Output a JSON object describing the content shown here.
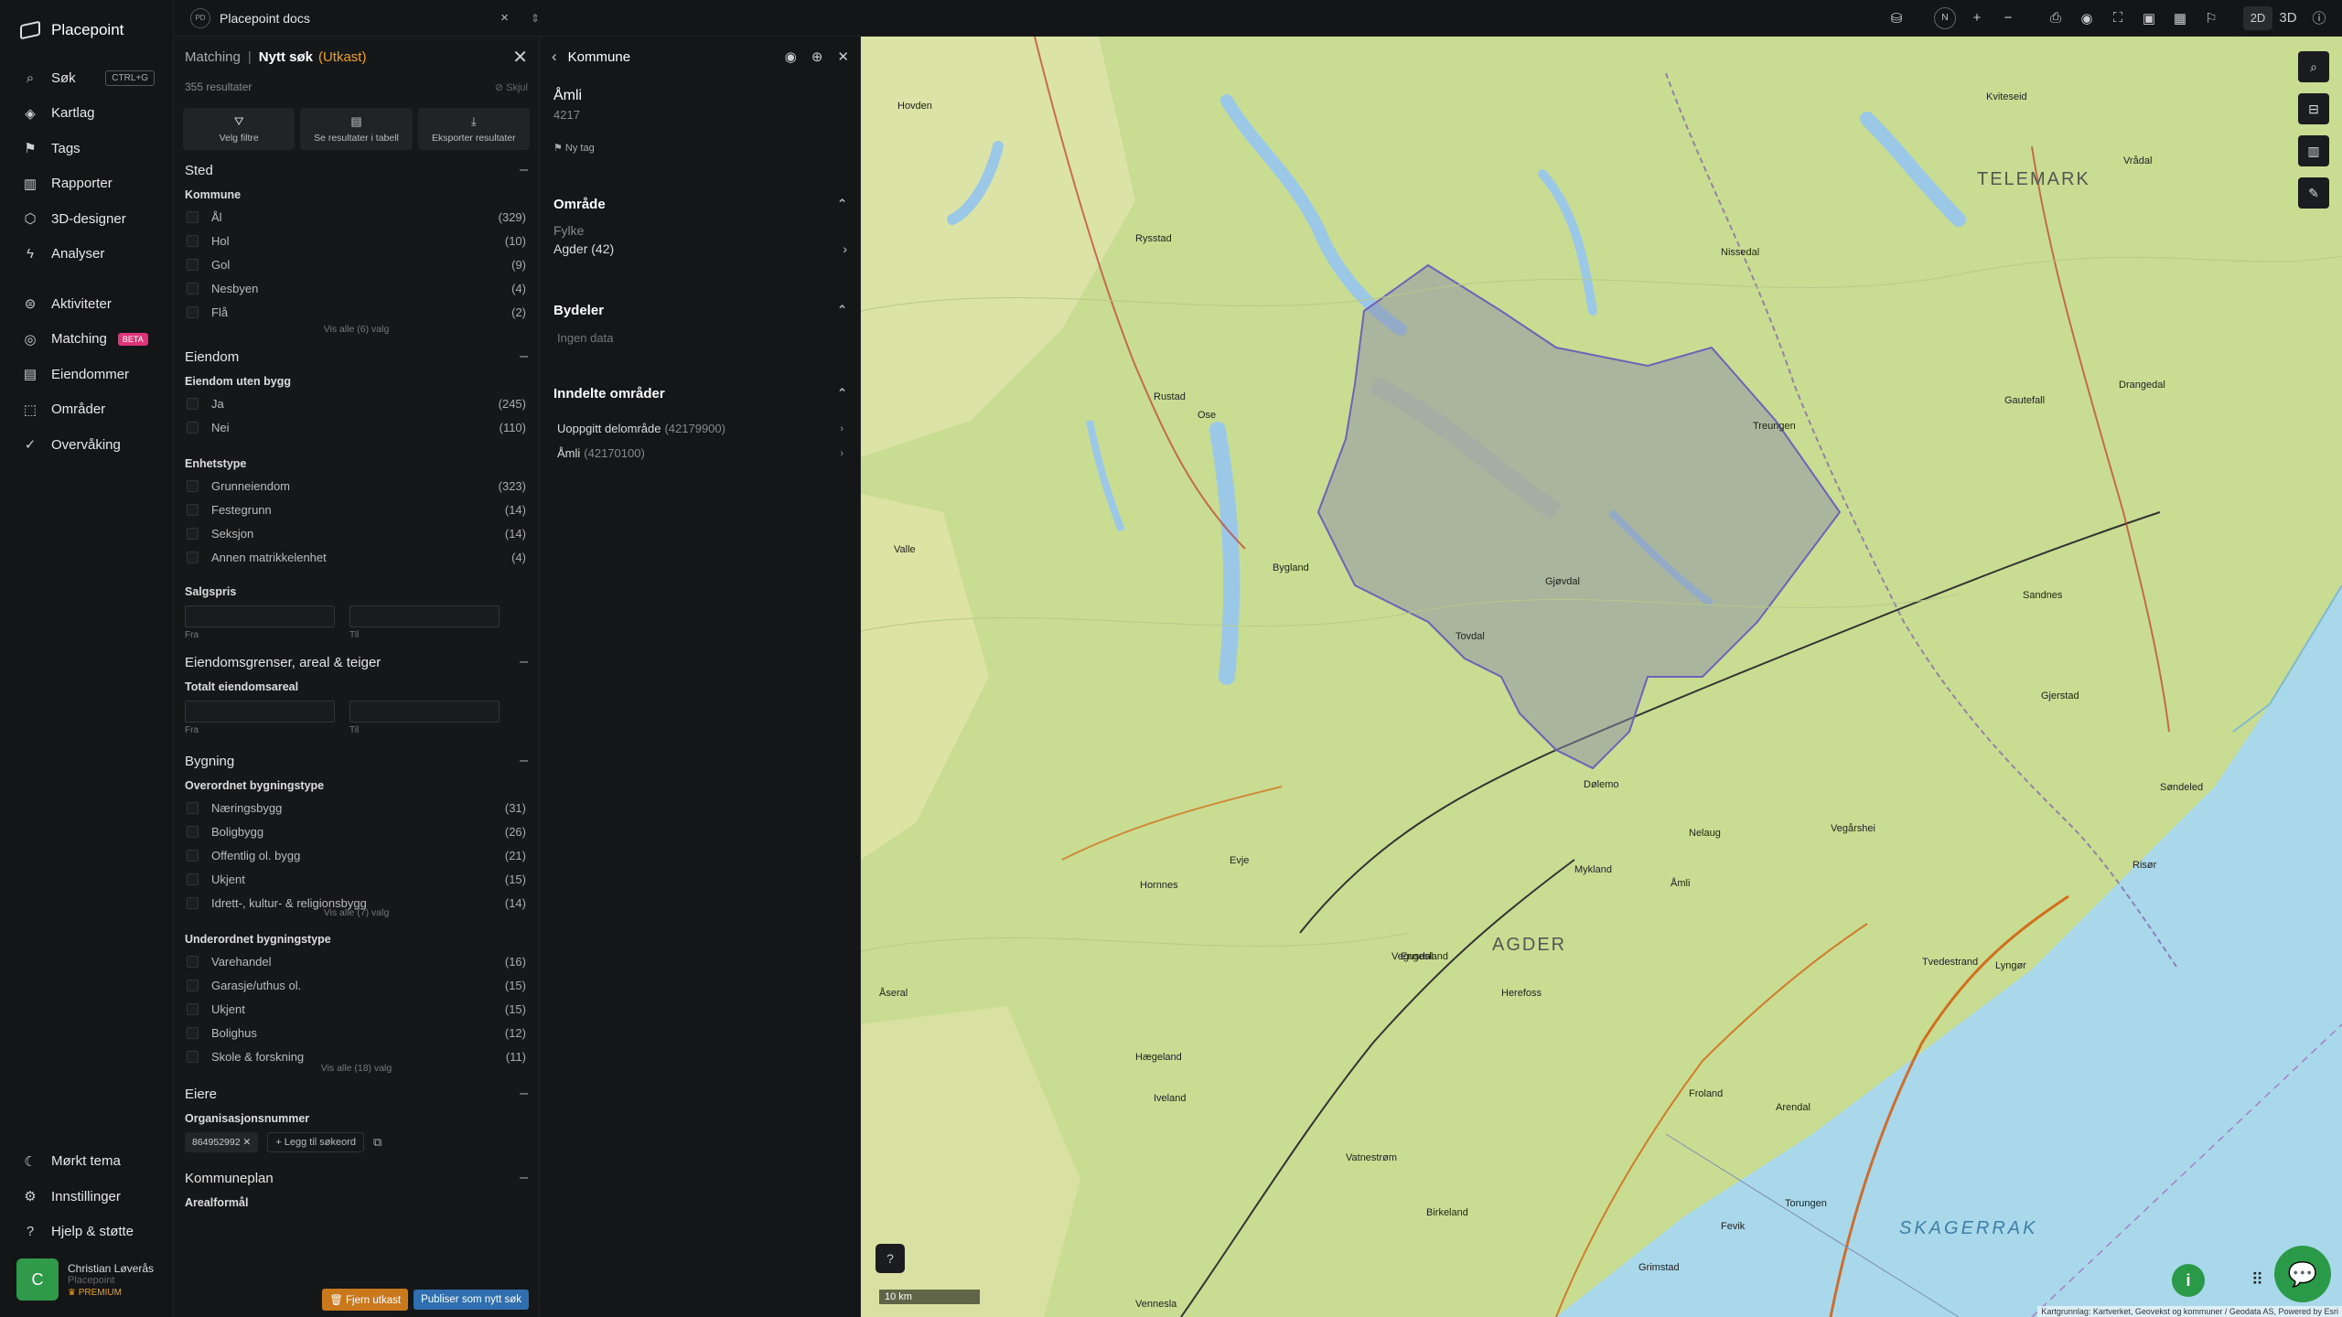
{
  "brand": "Placepoint",
  "nav": {
    "items": [
      {
        "label": "Søk",
        "icon": "search-icon",
        "shortcut": "CTRL+G"
      },
      {
        "label": "Kartlag",
        "icon": "layers-icon"
      },
      {
        "label": "Tags",
        "icon": "bookmark-icon"
      },
      {
        "label": "Rapporter",
        "icon": "chart-icon"
      },
      {
        "label": "3D-designer",
        "icon": "cube-icon"
      },
      {
        "label": "Analyser",
        "icon": "bolt-icon"
      }
    ],
    "items2": [
      {
        "label": "Aktiviteter",
        "icon": "activity-icon"
      },
      {
        "label": "Matching",
        "icon": "target-icon",
        "badge": "BETA"
      },
      {
        "label": "Eiendommer",
        "icon": "building-icon"
      },
      {
        "label": "Områder",
        "icon": "area-icon"
      },
      {
        "label": "Overvåking",
        "icon": "check-circle-icon"
      }
    ],
    "bottom": [
      {
        "label": "Mørkt tema",
        "icon": "moon-icon"
      },
      {
        "label": "Innstillinger",
        "icon": "gear-icon"
      },
      {
        "label": "Hjelp & støtte",
        "icon": "help-icon"
      }
    ],
    "user": {
      "initial": "C",
      "name": "Christian Løverås",
      "org": "Placepoint",
      "plan": "PREMIUM"
    }
  },
  "topbar": {
    "project_badge": "PD",
    "project": "Placepoint docs",
    "view2d": "2D",
    "view3d": "3D",
    "compass": "N"
  },
  "filter": {
    "crumb": "Matching",
    "title": "Nytt søk",
    "draft": "(Utkast)",
    "results": "355 resultater",
    "hide": "Skjul",
    "actions": [
      "Velg filtre",
      "Se resultater i tabell",
      "Eksporter resultater"
    ],
    "sted": {
      "title": "Sted",
      "group": "Kommune",
      "options": [
        [
          "Ål",
          "(329)"
        ],
        [
          "Hol",
          "(10)"
        ],
        [
          "Gol",
          "(9)"
        ],
        [
          "Nesbyen",
          "(4)"
        ],
        [
          "Flå",
          "(2)"
        ]
      ],
      "more": "Vis alle (6) valg"
    },
    "eiendom": {
      "title": "Eiendom",
      "group1": "Eiendom uten bygg",
      "options1": [
        [
          "Ja",
          "(245)"
        ],
        [
          "Nei",
          "(110)"
        ]
      ],
      "group2": "Enhetstype",
      "options2": [
        [
          "Grunneiendom",
          "(323)"
        ],
        [
          "Festegrunn",
          "(14)"
        ],
        [
          "Seksjon",
          "(14)"
        ],
        [
          "Annen matrikkelenhet",
          "(4)"
        ]
      ],
      "group3": "Salgspris",
      "from": "Fra",
      "to": "Til"
    },
    "grenser": {
      "title": "Eiendomsgrenser, areal & teiger",
      "group": "Totalt eiendomsareal",
      "from": "Fra",
      "to": "Til"
    },
    "bygning": {
      "title": "Bygning",
      "group1": "Overordnet bygningstype",
      "options1": [
        [
          "Næringsbygg",
          "(31)"
        ],
        [
          "Boligbygg",
          "(26)"
        ],
        [
          "Offentlig ol. bygg",
          "(21)"
        ],
        [
          "Ukjent",
          "(15)"
        ],
        [
          "Idrett-, kultur- & religionsbygg",
          "(14)"
        ]
      ],
      "more1": "Vis alle (7) valg",
      "group2": "Underordnet bygningstype",
      "options2": [
        [
          "Varehandel",
          "(16)"
        ],
        [
          "Garasje/uthus ol.",
          "(15)"
        ],
        [
          "Ukjent",
          "(15)"
        ],
        [
          "Bolighus",
          "(12)"
        ],
        [
          "Skole & forskning",
          "(11)"
        ]
      ],
      "more2": "Vis alle (18) valg"
    },
    "eiere": {
      "title": "Eiere",
      "group": "Organisasjonsnummer",
      "chip": "864952992",
      "add": "Legg til søkeord"
    },
    "kommuneplan": {
      "title": "Kommuneplan",
      "group": "Arealformål"
    },
    "remove_btn": "Fjern utkast",
    "publish_btn": "Publiser som nytt søk"
  },
  "detail": {
    "title": "Kommune",
    "name": "Åmli",
    "code": "4217",
    "tag": "Ny tag",
    "omrade": {
      "title": "Område",
      "label": "Fylke",
      "value": "Agder (42)"
    },
    "bydeler": {
      "title": "Bydeler",
      "empty": "Ingen data"
    },
    "inndelte": {
      "title": "Inndelte områder",
      "items": [
        [
          "Uoppgitt delområde",
          "(42179900)"
        ],
        [
          "Åmli",
          "(42170100)"
        ]
      ]
    }
  },
  "map": {
    "labels": [
      "TELEMARK",
      "AGDER",
      "SKAGERRAK",
      "Åmli",
      "Dølemo",
      "Nelaug",
      "Tovdal",
      "Gjøvdal",
      "Bygland",
      "Evje",
      "Froland",
      "Arendal",
      "Tvedestrand",
      "Risør",
      "Vegårshei",
      "Treungen",
      "Kviteseid",
      "Nissedal",
      "Grimstad",
      "Fevik",
      "Torungen",
      "Lyngør",
      "Birkeland",
      "Vennesla",
      "Iveland",
      "Åseral",
      "Hornnes",
      "Valle",
      "Rysstad",
      "Vrådal",
      "Drangedal",
      "Gautefall",
      "Sandnes",
      "Søndeled",
      "Gjerstad",
      "Vegusdal",
      "Herefoss",
      "Hægeland",
      "Vatnestrøm",
      "Engesland",
      "Mykland",
      "Ose",
      "Rustad",
      "Hovden"
    ],
    "scale": "10 km",
    "attribution": "Kartgrunnlag: Kartverket, Geovekst og kommuner / Geodata AS, Powered by Esri"
  }
}
